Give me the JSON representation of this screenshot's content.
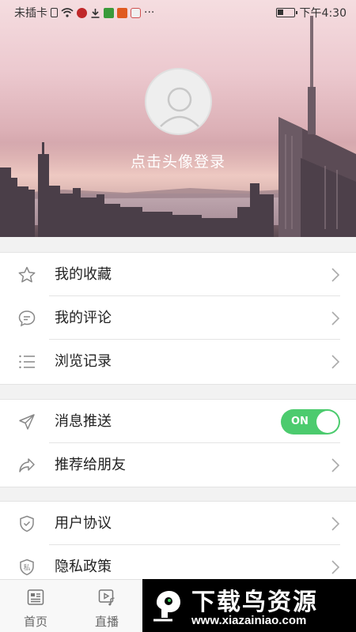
{
  "status_bar": {
    "carrier": "未插卡",
    "more": "···",
    "time": "下午4:30",
    "battery_level": 0.35
  },
  "profile": {
    "login_prompt": "点击头像登录"
  },
  "menu": {
    "group1": [
      {
        "label": "我的收藏",
        "icon": "star-icon"
      },
      {
        "label": "我的评论",
        "icon": "comment-icon"
      },
      {
        "label": "浏览记录",
        "icon": "list-icon"
      }
    ],
    "group2": [
      {
        "label": "消息推送",
        "icon": "send-icon",
        "toggle": "ON"
      },
      {
        "label": "推荐给朋友",
        "icon": "share-icon"
      }
    ],
    "group3": [
      {
        "label": "用户协议",
        "icon": "shield-check-icon"
      },
      {
        "label": "隐私政策",
        "icon": "privacy-shield-icon",
        "icon_text": "私"
      }
    ]
  },
  "tabbar": {
    "tabs": [
      {
        "label": "首页",
        "icon": "news-icon"
      },
      {
        "label": "直播",
        "icon": "video-music-icon"
      }
    ]
  },
  "watermark": {
    "title": "下载鸟资源",
    "url": "www.xiazainiao.com"
  },
  "colors": {
    "accent_green": "#4ccb6e",
    "background": "#f2f2f2"
  }
}
